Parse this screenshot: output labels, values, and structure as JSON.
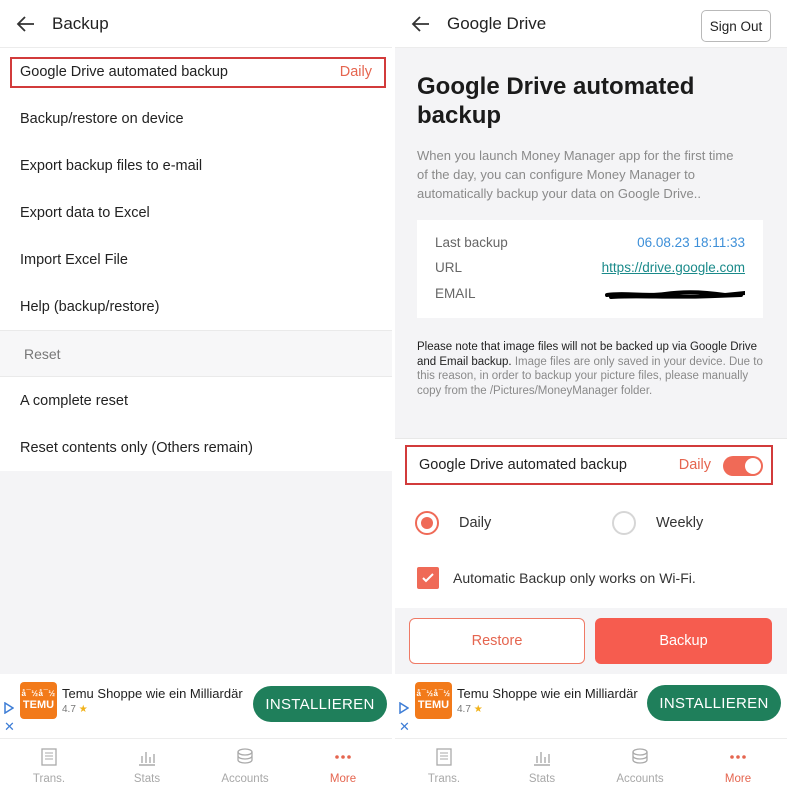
{
  "colors": {
    "accent": "#e5654f",
    "highlight_border": "#d23b3b",
    "install_button": "#1f7f5b",
    "link": "#1a8a8a",
    "date": "#3d8fd8"
  },
  "left": {
    "header": {
      "title": "Backup",
      "back_icon": "arrow-left-icon"
    },
    "menu": [
      {
        "label": "Google Drive automated backup",
        "value": "Daily"
      },
      {
        "label": "Backup/restore on device"
      },
      {
        "label": "Export backup files to e-mail"
      },
      {
        "label": "Export data to Excel"
      },
      {
        "label": "Import Excel File"
      },
      {
        "label": "Help (backup/restore)"
      }
    ],
    "reset_section": {
      "title": "Reset",
      "items": [
        {
          "label": "A complete reset"
        },
        {
          "label": "Reset contents only (Others remain)"
        }
      ]
    }
  },
  "right": {
    "header": {
      "title": "Google Drive",
      "sign_out": "Sign Out",
      "back_icon": "arrow-left-icon"
    },
    "title": "Google Drive automated backup",
    "description": "When you launch Money Manager app for the first time of the day, you can configure Money Manager to automatically backup your data on Google Drive..",
    "info": {
      "last_backup_label": "Last backup",
      "last_backup_value": "06.08.23 18:11:33",
      "url_label": "URL",
      "url_value": "https://drive.google.com",
      "email_label": "EMAIL"
    },
    "note_bold": "Please note that image files will not be backed up via Google Drive and Email backup.",
    "note_rest": " Image files are only saved in your device. Due to this reason, in order to backup your picture files, please manually copy from the /Pictures/MoneyManager folder.",
    "toggle": {
      "label": "Google Drive automated backup",
      "value": "Daily",
      "enabled": true
    },
    "frequency": {
      "options": [
        "Daily",
        "Weekly"
      ],
      "selected": "Daily"
    },
    "wifi": {
      "label": "Automatic Backup only works on Wi-Fi.",
      "checked": true
    },
    "buttons": {
      "restore": "Restore",
      "backup": "Backup"
    }
  },
  "ad": {
    "logo_top": "å¯½å¯½",
    "logo_name": "TEMU",
    "title": "Temu Shoppe wie ein Milliardär",
    "rating": "4.7",
    "install": "INSTALLIEREN"
  },
  "nav": {
    "items": [
      {
        "label": "Trans.",
        "icon": "notebook-icon"
      },
      {
        "label": "Stats",
        "icon": "bar-chart-icon"
      },
      {
        "label": "Accounts",
        "icon": "coins-icon"
      },
      {
        "label": "More",
        "icon": "more-dots-icon"
      }
    ],
    "active": "More"
  }
}
